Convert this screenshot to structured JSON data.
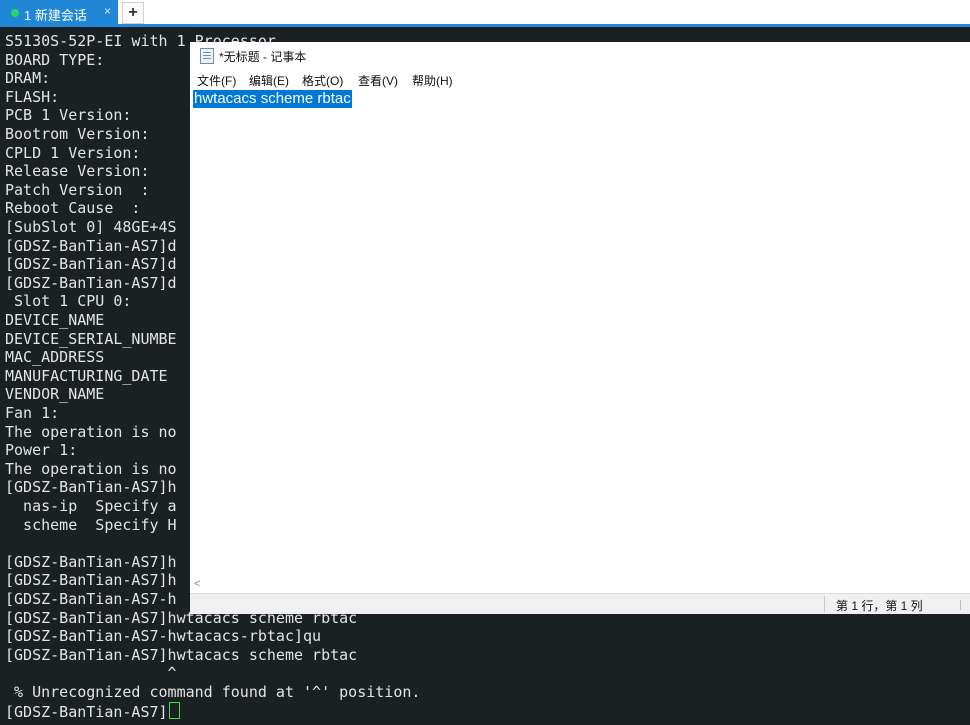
{
  "tabs": [
    {
      "label": "1 新建会话",
      "close": "×"
    }
  ],
  "new_tab_label": "+",
  "terminal": {
    "lines": [
      "S5130S-52P-EI with 1 Processor",
      "BOARD TYPE:",
      "DRAM:",
      "FLASH:",
      "PCB 1 Version:",
      "Bootrom Version:",
      "CPLD 1 Version:",
      "Release Version:",
      "Patch Version  :",
      "Reboot Cause  :",
      "[SubSlot 0] 48GE+4S",
      "[GDSZ-BanTian-AS7]d",
      "[GDSZ-BanTian-AS7]d",
      "[GDSZ-BanTian-AS7]d",
      " Slot 1 CPU 0:",
      "DEVICE_NAME",
      "DEVICE_SERIAL_NUMBE",
      "MAC_ADDRESS",
      "MANUFACTURING_DATE",
      "VENDOR_NAME",
      "Fan 1:",
      "The operation is no",
      "Power 1:",
      "The operation is no",
      "[GDSZ-BanTian-AS7]h",
      "  nas-ip  Specify a",
      "  scheme  Specify H",
      "",
      "[GDSZ-BanTian-AS7]h",
      "[GDSZ-BanTian-AS7]h",
      "[GDSZ-BanTian-AS7-h",
      "[GDSZ-BanTian-AS7]hwtacacs scheme rbtac",
      "[GDSZ-BanTian-AS7-hwtacacs-rbtac]qu",
      "[GDSZ-BanTian-AS7]hwtacacs scheme rbtac",
      "                  ^",
      " % Unrecognized command found at '^' position.",
      "[GDSZ-BanTian-AS7]"
    ]
  },
  "notepad": {
    "title": "*无标题 - 记事本",
    "menu": [
      "文件(F)",
      "编辑(E)",
      "格式(O)",
      "查看(V)",
      "帮助(H)"
    ],
    "content": "hwtacacs scheme rbtac",
    "scroll_left_arrow": "<",
    "status": "第 1 行，第 1 列"
  },
  "colors": {
    "terminal_bg": "#1b2023",
    "tab_accent": "#1f87d6",
    "cursor": "#3fe04f",
    "selection": "#0078d7"
  }
}
